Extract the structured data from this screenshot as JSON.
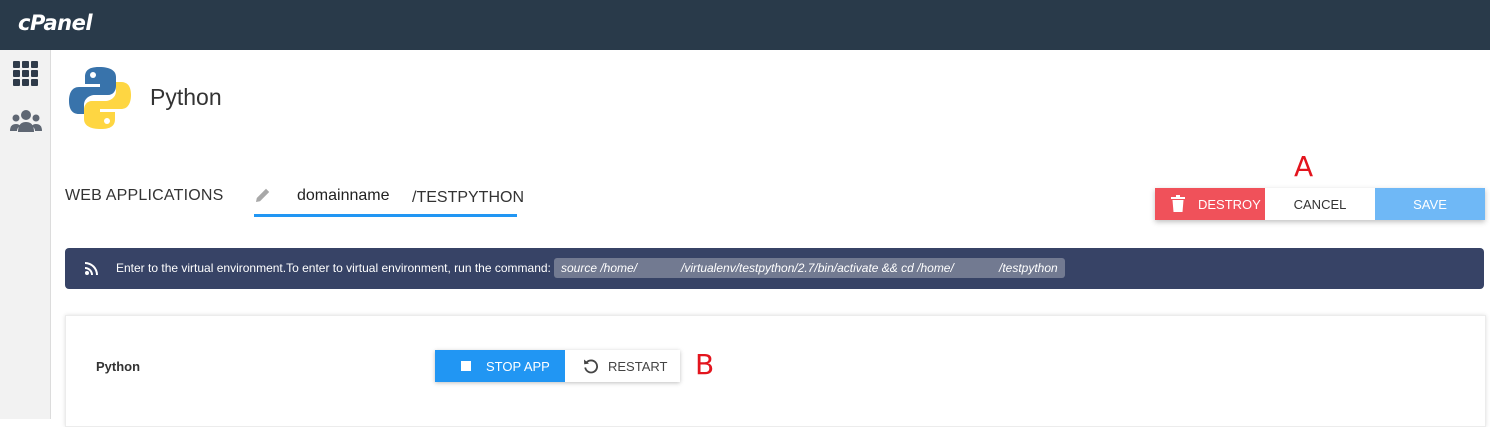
{
  "header": {
    "brand": "cPanel"
  },
  "sidebar": {
    "items": [
      {
        "icon": "grid-icon"
      },
      {
        "icon": "users-icon"
      }
    ]
  },
  "page": {
    "title": "Python"
  },
  "web_apps": {
    "label": "WEB APPLICATIONS",
    "url_domain": "domainname",
    "url_path": "/TESTPYTHON"
  },
  "actions": {
    "destroy_label": "DESTROY",
    "cancel_label": "CANCEL",
    "save_label": "SAVE"
  },
  "annotations": {
    "a": "A",
    "b": "B"
  },
  "notice": {
    "text": "Enter to the virtual environment.To enter to virtual environment, run the command:",
    "command_part1": "source /home/",
    "command_part2": "/virtualenv/testpython/2.7/bin/activate && cd /home/",
    "command_part3": "/testpython"
  },
  "app_panel": {
    "label": "Python",
    "stop_label": "STOP APP",
    "restart_label": "RESTART"
  },
  "colors": {
    "topbar": "#293a4a",
    "accent_blue": "#2196f3",
    "save_blue": "#6fb8f6",
    "destroy_red": "#f0515a",
    "notice_bg": "#374366",
    "annotation_red": "#e3151e"
  }
}
